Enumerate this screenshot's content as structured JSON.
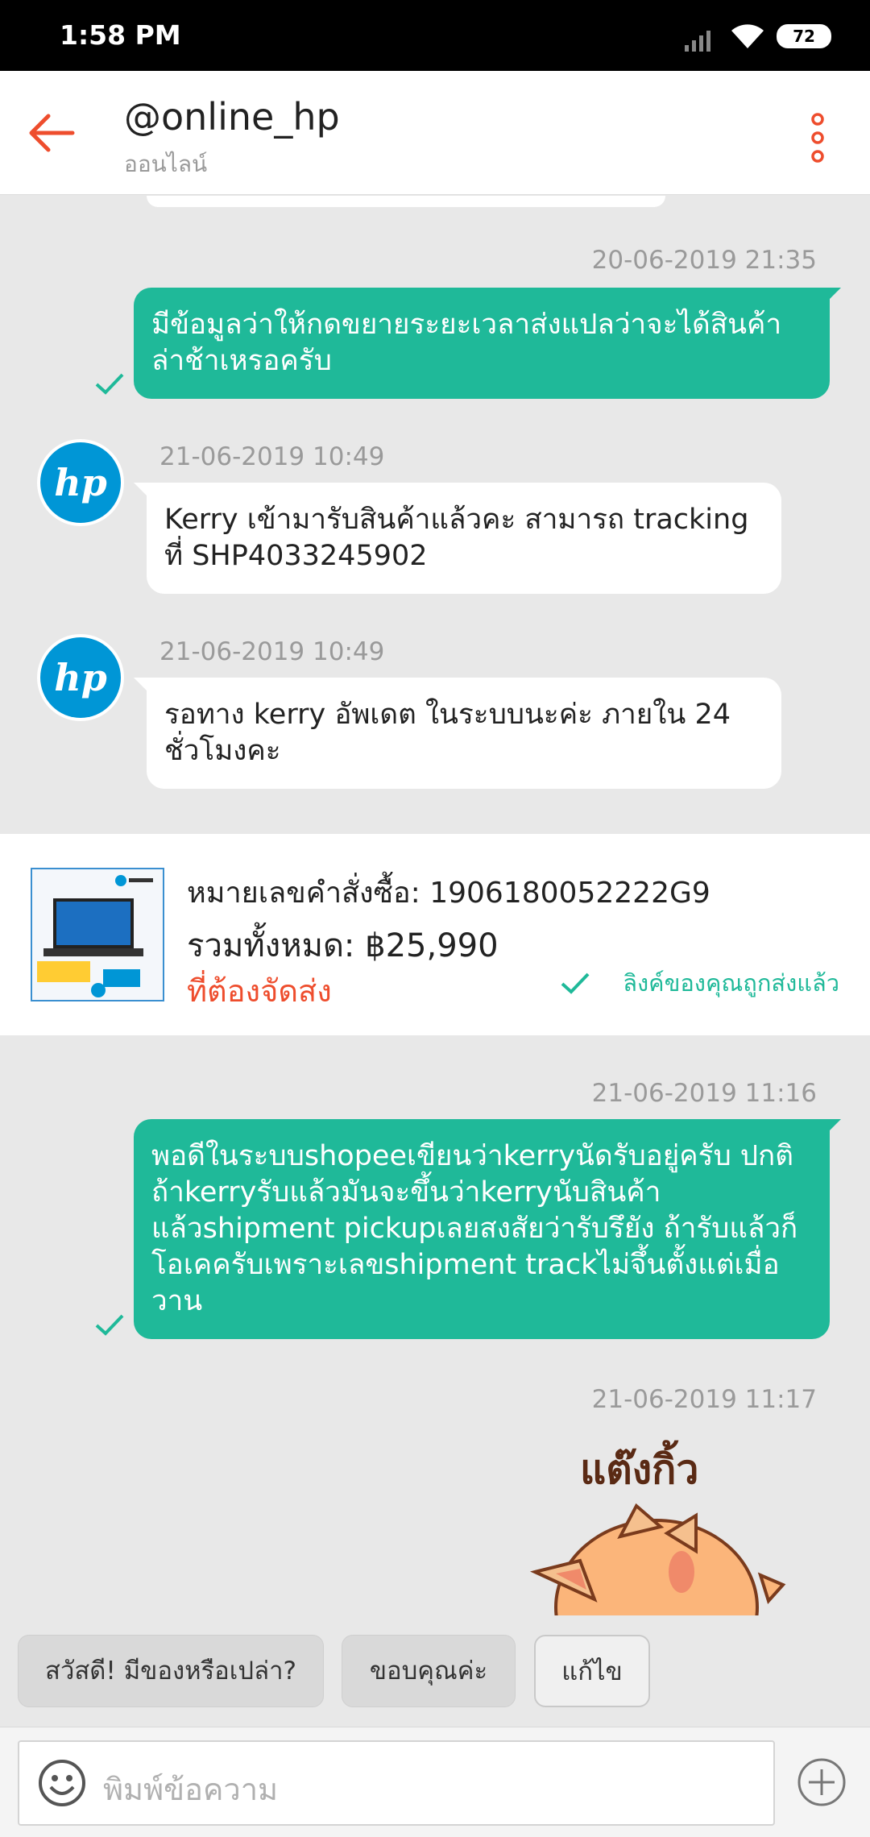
{
  "status_bar": {
    "time": "1:58 PM",
    "battery": "72",
    "icons": [
      "signal-icon",
      "wifi-icon",
      "battery-icon"
    ]
  },
  "header": {
    "back_icon": "arrow-left-icon",
    "title": "@online_hp",
    "subtitle": "ออนไลน์",
    "menu_icon": "more-vertical-icon"
  },
  "colors": {
    "accent": "#ee4d2d",
    "outgoing_bubble": "#1fb999",
    "background": "#e8e8e8",
    "hp_blue": "#0096d6"
  },
  "messages": [
    {
      "id": "m1",
      "direction": "out",
      "timestamp": "20-06-2019 21:35",
      "text": "มีข้อมูลว่าให้กดขยายระยะเวลาส่งแปลว่าจะได้สินค้าล่าช้าเหรอครับ",
      "status_icon": "check-icon"
    },
    {
      "id": "m2",
      "direction": "in",
      "timestamp": "21-06-2019 10:49",
      "text": " Kerry เข้ามารับสินค้าแล้วคะ สามารถ tracking ที่ SHP4033245902",
      "avatar": "hp-logo"
    },
    {
      "id": "m3",
      "direction": "in",
      "timestamp": "21-06-2019 10:49",
      "text": "รอทาง kerry อัพเดต ในระบบนะค่ะ ภายใน 24 ชั่วโมงคะ",
      "avatar": "hp-logo"
    },
    {
      "id": "m4",
      "direction": "out",
      "timestamp": "21-06-2019 11:16",
      "text": "พอดีในระบบshopeeเขียนว่าkerryนัดรับอยู่ครับ ปกติถ้าkerryรับแล้วมันจะขึ้นว่าkerryนับสินค้าแล้วshipment pickupเลยสงสัยว่ารับรึยัง ถ้ารับแล้วก็โอเคครับเพราะเลขshipment trackไม่จึ้นตั้งแต่เมื่อวาน",
      "status_icon": "check-icon"
    },
    {
      "id": "m5",
      "direction": "out",
      "timestamp": "21-06-2019 11:17",
      "sticker_text": "แต๊งกิ้ว"
    }
  ],
  "order_card": {
    "order_number_line": "หมายเลขคำสั่งซื้อ: 1906180052222G9",
    "total_label": "รวมทั้งหมด: ",
    "total_value": "฿25,990",
    "status": "ที่ต้องจัดส่ง",
    "link_status": "ลิงค์ของคุณถูกส่งแล้ว"
  },
  "quick_replies": [
    "สวัสดี! มีของหรือเปล่า?",
    "ขอบคุณค่ะ",
    "แก้ไข"
  ],
  "composer": {
    "placeholder": "พิมพ์ข้อความ",
    "emoji_icon": "smiley-icon",
    "add_icon": "plus-circle-icon"
  }
}
